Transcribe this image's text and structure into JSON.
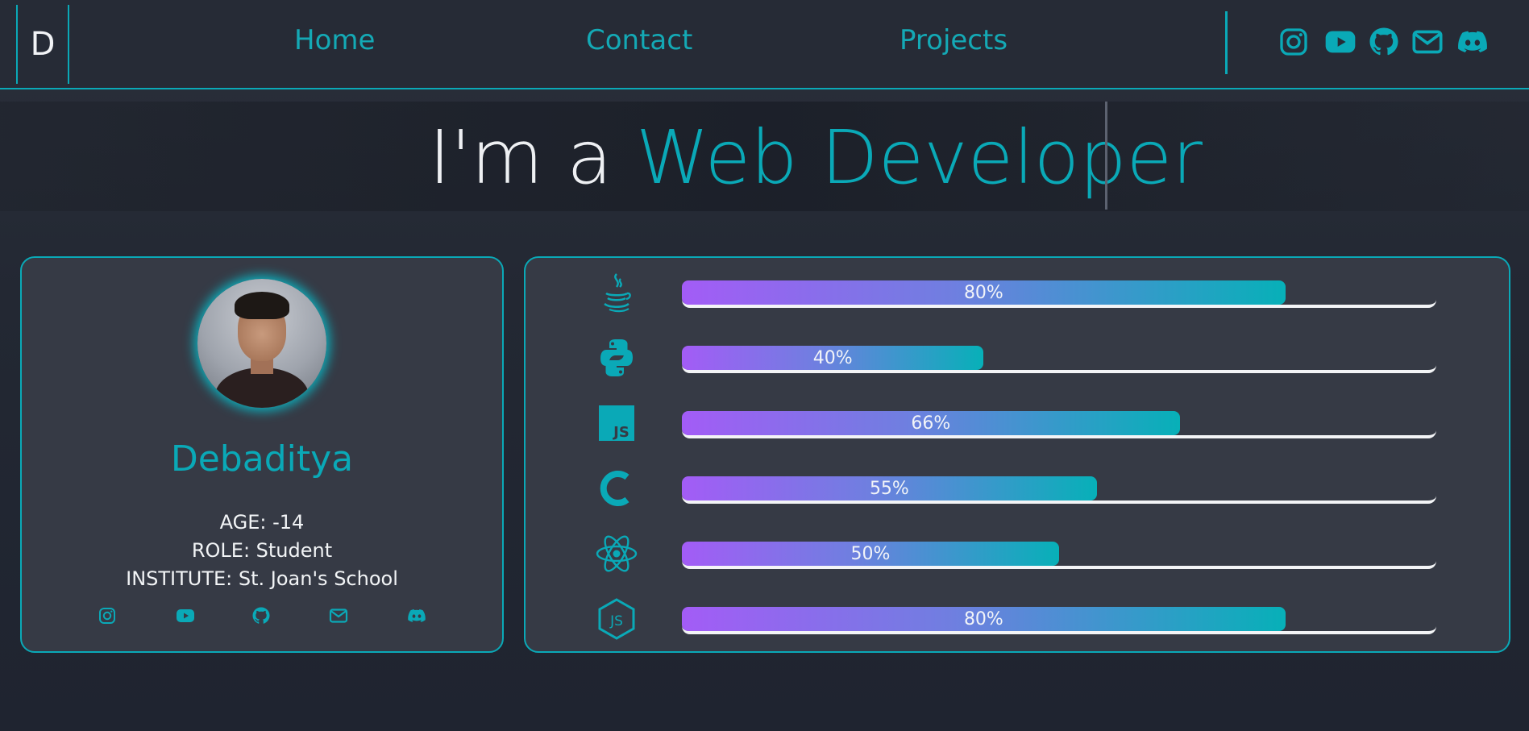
{
  "colors": {
    "accent": "#0aa9b7",
    "background": "#232833",
    "card": "#363a45",
    "bar_start": "#a35cf6",
    "bar_end": "#07b0b8"
  },
  "nav": {
    "logo": "D",
    "links": [
      {
        "label": "Home"
      },
      {
        "label": "Contact"
      },
      {
        "label": "Projects"
      }
    ],
    "social_icons": [
      "instagram-icon",
      "youtube-icon",
      "github-icon",
      "mail-icon",
      "discord-icon"
    ]
  },
  "hero": {
    "prefix": "I'm a ",
    "highlight": "Web Developer"
  },
  "profile": {
    "name": "Debaditya",
    "age_line": "AGE: -14",
    "role_line": "ROLE: Student",
    "institute_line": "INSTITUTE: St. Joan's School",
    "social_icons": [
      "instagram-icon",
      "youtube-icon",
      "github-icon",
      "mail-icon",
      "discord-icon"
    ]
  },
  "skills": [
    {
      "icon": "java-icon",
      "percent": 80,
      "label": "80%"
    },
    {
      "icon": "python-icon",
      "percent": 40,
      "label": "40%"
    },
    {
      "icon": "javascript-icon",
      "percent": 66,
      "label": "66%"
    },
    {
      "icon": "c-language-icon",
      "percent": 55,
      "label": "55%"
    },
    {
      "icon": "react-icon",
      "percent": 50,
      "label": "50%"
    },
    {
      "icon": "nodejs-icon",
      "percent": 80,
      "label": "80%"
    }
  ]
}
